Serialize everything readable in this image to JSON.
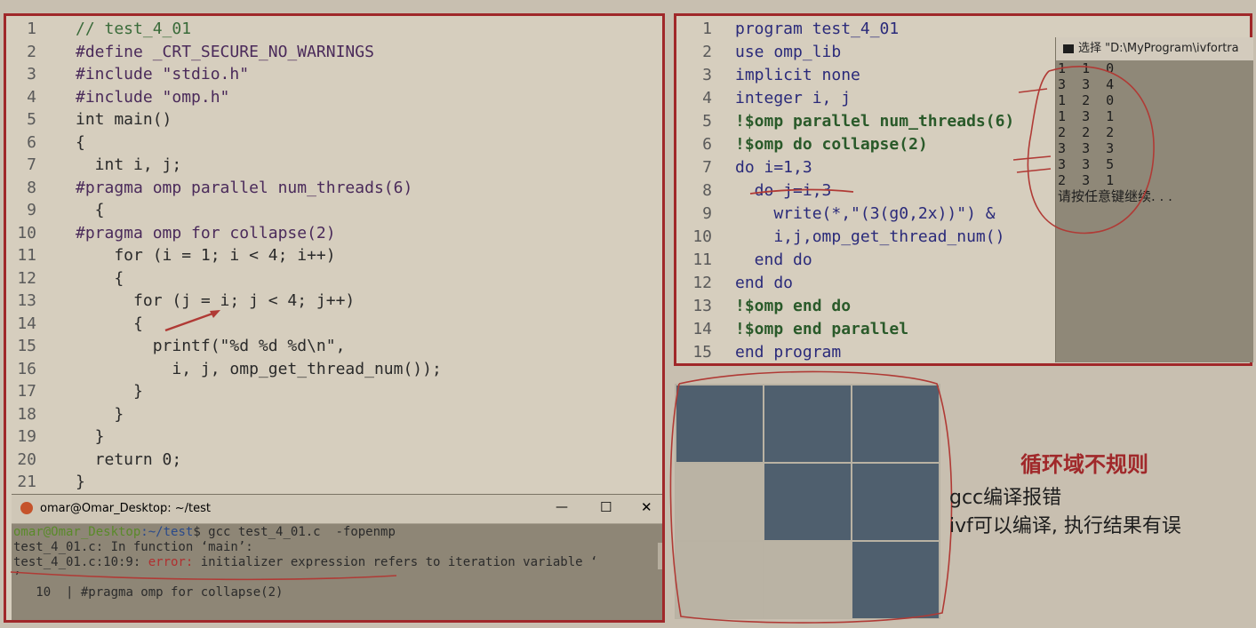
{
  "left_code": {
    "line_numbers": [
      "1",
      "2",
      "3",
      "4",
      "5",
      "6",
      "7",
      "8",
      "9",
      "10",
      "11",
      "12",
      "13",
      "14",
      "15",
      "16",
      "17",
      "18",
      "19",
      "20",
      "21"
    ],
    "lines": [
      "// test_4_01",
      "#define _CRT_SECURE_NO_WARNINGS",
      "#include \"stdio.h\"",
      "#include \"omp.h\"",
      "int main()",
      "{",
      "  int i, j;",
      "#pragma omp parallel num_threads(6)",
      "  {",
      "#pragma omp for collapse(2)",
      "    for (i = 1; i < 4; i++)",
      "    {",
      "      for (j = i; j < 4; j++)",
      "      {",
      "        printf(\"%d %d %d\\n\",",
      "          i, j, omp_get_thread_num());",
      "      }",
      "    }",
      "  }",
      "  return 0;",
      "}"
    ]
  },
  "terminal": {
    "title": "omar@Omar_Desktop: ~/test",
    "minimize": "—",
    "maximize": "☐",
    "close": "✕",
    "line1_user": "omar@Omar_Desktop",
    "line1_path": ":~/test",
    "line1_cmd": "$ gcc test_4_01.c  -fopenmp",
    "line2": "test_4_01.c: In function ‘main’:",
    "line3_loc": "test_4_01.c:10:9: ",
    "line3_err": "error:",
    "line3_msg": " initializer expression refers to iteration variable ‘",
    "line4": "’",
    "line5_num": "10",
    "line5_code": "#pragma omp for collapse(2)"
  },
  "fortran_code": {
    "line_numbers": [
      "1",
      "2",
      "3",
      "4",
      "5",
      "6",
      "7",
      "8",
      "9",
      "10",
      "11",
      "12",
      "13",
      "14",
      "15"
    ],
    "lines": [
      "program test_4_01",
      "use omp_lib",
      "implicit none",
      "integer i, j",
      "!$omp parallel num_threads(6)",
      "!$omp do collapse(2)",
      "do i=1,3",
      "  do j=i,3",
      "    write(*,\"(3(g0,2x))\") &",
      "    i,j,omp_get_thread_num()",
      "  end do",
      "end do",
      "!$omp end do",
      "!$omp end parallel",
      "end program"
    ]
  },
  "console": {
    "title": "选择 \"D:\\MyProgram\\ivfortra",
    "output": [
      "1  1  0",
      "3  3  4",
      "1  2  0",
      "1  3  1",
      "2  2  2",
      "3  3  3",
      "3  3  5",
      "2  3  1"
    ],
    "prompt": "请按任意键继续. . ."
  },
  "notes": {
    "heading": "循环域不规则",
    "line1": "gcc编译报错",
    "line2": "ivf可以编译, 执行结果有误"
  },
  "grid": {
    "filled": [
      [
        1,
        1,
        1
      ],
      [
        0,
        1,
        1
      ],
      [
        0,
        0,
        1
      ]
    ]
  },
  "colors": {
    "accent": "#a0282a",
    "cell_filled": "#4f5f6e"
  }
}
